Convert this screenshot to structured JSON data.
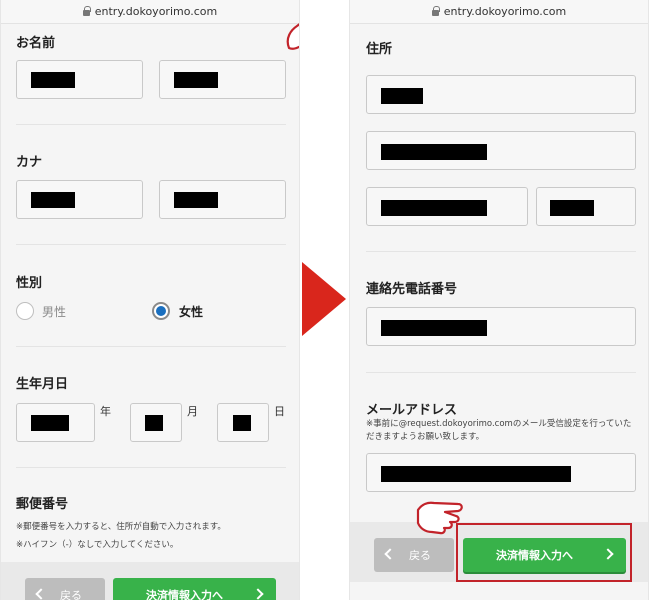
{
  "url": "entry.dokoyorimo.com",
  "left": {
    "name_label": "お名前",
    "kana_label": "カナ",
    "gender_label": "性別",
    "gender_male": "男性",
    "gender_female": "女性",
    "gender_selected": "女性",
    "birth_label": "生年月日",
    "year_suffix": "年",
    "month_suffix": "月",
    "day_suffix": "日",
    "postal_label": "郵便番号",
    "postal_note_1": "※郵便番号を入力すると、住所が自動で入力されます。",
    "postal_note_2": "※ハイフン（-）なしで入力してください。",
    "back_label": "戻る",
    "next_label": "決済情報入力へ"
  },
  "right": {
    "address_label": "住所",
    "phone_label": "連絡先電話番号",
    "email_label": "メールアドレス",
    "email_note": "※事前に@request.dokoyorimo.comのメール受信設定を行っていただきますようお願い致します。",
    "back_label": "戻る",
    "next_label": "決済情報入力へ"
  },
  "colors": {
    "next_button": "#38b24a",
    "back_button": "#bdbdbd",
    "arrow": "#d9261c",
    "highlight_box": "#c2232a",
    "radio_selected": "#1a6fbf"
  },
  "icons": {
    "hand": "pointing-hand-icon",
    "arrow": "triangle-right-icon"
  }
}
